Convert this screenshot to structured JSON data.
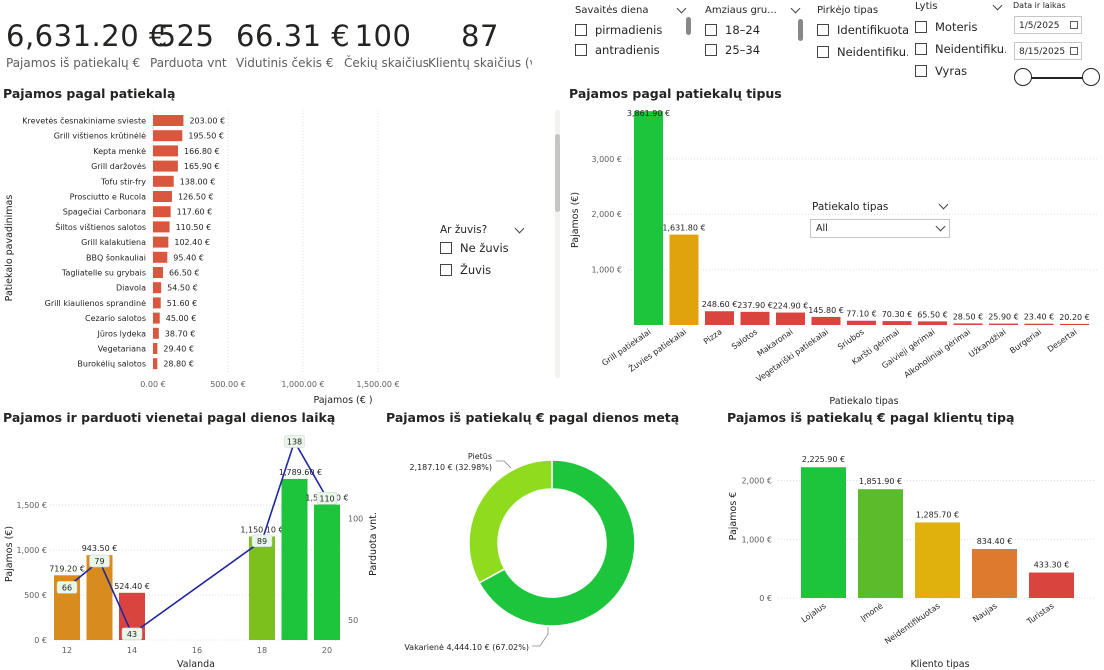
{
  "kpis": [
    {
      "value": "6,631.20 €",
      "label": "Pajamos iš patiekalų €"
    },
    {
      "value": "525",
      "label": "Parduota vnt"
    },
    {
      "value": "66.31 €",
      "label": "Vidutinis čekis €"
    },
    {
      "value": "100",
      "label": "Čekių skaičius"
    },
    {
      "value": "87",
      "label": "Klientų skaičius (v..."
    }
  ],
  "slicers": {
    "weekday": {
      "title": "Savaitės diena",
      "options": [
        "pirmadienis",
        "antradienis"
      ]
    },
    "age": {
      "title": "Amziaus gru...",
      "options": [
        "18–24",
        "25–34"
      ]
    },
    "buyer": {
      "title": "Pirkėjo tipas",
      "options": [
        "Identifikuotas",
        "Neidentifiku..."
      ]
    },
    "gender": {
      "title": "Lytis",
      "options": [
        "Moteris",
        "Neidentifiku...",
        "Vyras"
      ]
    },
    "date": {
      "title": "Data ir laikas",
      "from": "1/5/2025",
      "to": "8/15/2025"
    },
    "fish": {
      "title": "Ar žuvis?",
      "options": [
        "Ne žuvis",
        "Žuvis"
      ]
    },
    "dish_type": {
      "title": "Patiekalo tipas",
      "selected": "All"
    }
  },
  "titles": {
    "dish": "Pajamos pagal patiekalą",
    "dish_type": "Pajamos pagal patiekalų tipus",
    "hour": "Pajamos ir parduoti vienetai pagal dienos laiką",
    "daytime": "Pajamos iš patiekalų € pagal dienos metą",
    "client": "Pajamos iš patiekalų € pagal klientų tipą"
  },
  "chart_data": [
    {
      "type": "bar",
      "orientation": "horizontal",
      "title": "Pajamos pagal patiekalą",
      "xlabel": "Pajamos (€ )",
      "ylabel": "Patiekalo pavadinimas",
      "xlim": [
        0,
        1800
      ],
      "xticks": [
        "0.00 €",
        "500.00 €",
        "1,000.00 €",
        "1,500.00 €"
      ],
      "categories": [
        "Krevetės česnakiniame svieste",
        "Grill vištienos krūtinėlė",
        "Kepta menkė",
        "Grill daržovės",
        "Tofu stir-fry",
        "Prosciutto e Rucola",
        "Spagečiai Carbonara",
        "Šiltos vištienos salotos",
        "Grill kalakutiena",
        "BBQ šonkauliai",
        "Tagliatelle su grybais",
        "Diavola",
        "Grill kiaulienos sprandinė",
        "Cezario salotos",
        "Jūros lydeka",
        "Vegetariana",
        "Burokėlių salotos"
      ],
      "values": [
        203.0,
        195.5,
        166.8,
        165.9,
        138.0,
        126.5,
        117.6,
        110.5,
        102.4,
        95.4,
        66.5,
        54.5,
        51.6,
        45.0,
        38.7,
        29.4,
        28.8
      ],
      "labels": [
        "203.00 €",
        "195.50 €",
        "166.80 €",
        "165.90 €",
        "138.00 €",
        "126.50 €",
        "117.60 €",
        "110.50 €",
        "102.40 €",
        "95.40 €",
        "66.50 €",
        "54.50 €",
        "51.60 €",
        "45.00 €",
        "38.70 €",
        "29.40 €",
        "28.80 €"
      ],
      "color": "#d9573e"
    },
    {
      "type": "bar",
      "title": "Pajamos pagal patiekalų tipus",
      "xlabel": "Patiekalo tipas",
      "ylabel": "Pajamos (€)",
      "ylim": [
        0,
        3900
      ],
      "yticks": [
        "1,000 €",
        "2,000 €",
        "3,000 €"
      ],
      "categories": [
        "Grill patiekalai",
        "Žuvies patiekalai",
        "Pizza",
        "Salotos",
        "Makaronai",
        "Vegetariški patiekalai",
        "Sriubos",
        "Karšti gėrimai",
        "Gaivieji gėrimai",
        "Alkoholiniai gėrimai",
        "Užkandžiai",
        "Burgeriai",
        "Desertai"
      ],
      "values": [
        3861.9,
        1631.8,
        248.6,
        237.9,
        224.9,
        145.8,
        77.1,
        70.3,
        65.5,
        28.5,
        25.9,
        23.4,
        20.2
      ],
      "labels": [
        "3,861.90 €",
        "1,631.80 €",
        "248.60 €",
        "237.90 €",
        "224.90 €",
        "145.80 €",
        "77.10 €",
        "70.30 €",
        "65.50 €",
        "28.50 €",
        "25.90 €",
        "23.40 €",
        "20.20 €"
      ],
      "colors": [
        "#1dc53d",
        "#e0a30c",
        "#d9443f",
        "#d9443f",
        "#d9443f",
        "#d9443f",
        "#d9443f",
        "#d9443f",
        "#d9443f",
        "#d9443f",
        "#d9443f",
        "#d9443f",
        "#d9443f"
      ]
    },
    {
      "type": "bar+line",
      "title": "Pajamos ir parduoti vienetai pagal dienos laiką",
      "xlabel": "Valanda",
      "ylabel": "Pajamos (€)",
      "y2label": "Parduota vnt.",
      "ylim": [
        0,
        1800
      ],
      "y2lim": [
        40,
        120
      ],
      "yticks": [
        "0 €",
        "500 €",
        "1,000 €",
        "1,500 €"
      ],
      "y2ticks": [
        "50",
        "100"
      ],
      "xticks": [
        "12",
        "14",
        "16",
        "18",
        "20"
      ],
      "x": [
        12,
        13,
        14,
        18,
        19,
        20
      ],
      "revenue": [
        719.2,
        943.5,
        524.4,
        1150.1,
        1789.6,
        1504.4
      ],
      "revenue_labels": [
        "719.20 €",
        "943.50 €",
        "524.40 €",
        "1,150.10 €",
        "1,789.60 €",
        "1,504.40 €"
      ],
      "units": [
        66,
        79,
        43,
        89,
        138,
        110
      ],
      "unit_labels": [
        "66",
        "79",
        "43",
        "89",
        "138",
        "110"
      ],
      "bar_colors": [
        "#d98c1e",
        "#d98c1e",
        "#d9443f",
        "#7cc01e",
        "#1dc53d",
        "#1dc53d"
      ],
      "line_color": "#1f27a0"
    },
    {
      "type": "pie",
      "title": "Pajamos iš patiekalų € pagal dienos metą",
      "donut": true,
      "categories": [
        "Vakarienė",
        "Pietūs"
      ],
      "values": [
        4444.1,
        2187.1
      ],
      "percents": [
        67.02,
        32.98
      ],
      "labels": [
        "Vakarienė 4,444.10 € (67.02%)",
        "2,187.10 € (32.98%)"
      ],
      "colors": [
        "#1dc53d",
        "#8fdc1e"
      ]
    },
    {
      "type": "bar",
      "title": "Pajamos iš patiekalų € pagal klientų tipą",
      "xlabel": "Kliento tipas",
      "ylabel": "Pajamos €",
      "ylim": [
        0,
        2400
      ],
      "yticks": [
        "0 €",
        "1,000 €",
        "2,000 €"
      ],
      "categories": [
        "Lojalus",
        "Įmonė",
        "Neidentifikuotas",
        "Naujas",
        "Turistas"
      ],
      "values": [
        2225.9,
        1851.9,
        1285.7,
        834.4,
        433.3
      ],
      "labels": [
        "2,225.90 €",
        "1,851.90 €",
        "1,285.70 €",
        "834.40 €",
        "433.30 €"
      ],
      "colors": [
        "#1dc53d",
        "#5cbb2a",
        "#e0b00c",
        "#dd7a2d",
        "#d9443f"
      ]
    }
  ]
}
